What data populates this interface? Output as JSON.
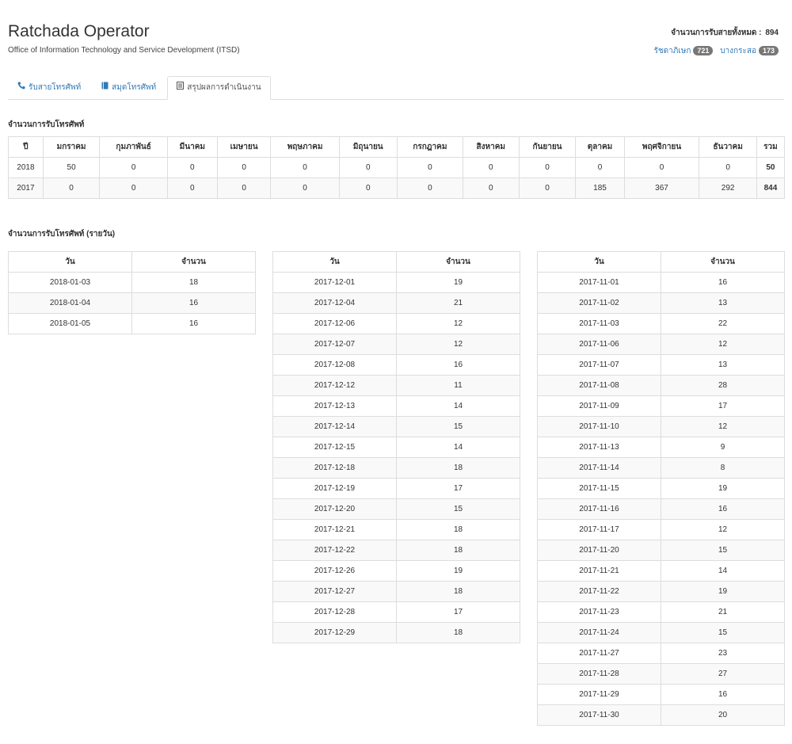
{
  "app": {
    "title": "Ratchada Operator",
    "subtitle": "Office of Information Technology and Service Development (ITSD)"
  },
  "summary": {
    "label": "จำนวนการรับสายทั้งหมด :",
    "total": "894",
    "branches": [
      {
        "name": "รัชดาภิเษก",
        "count": "721"
      },
      {
        "name": "บางกระสอ",
        "count": "173"
      }
    ]
  },
  "tabs": [
    {
      "label": "รับสายโทรศัพท์",
      "icon": "phone-icon"
    },
    {
      "label": "สมุดโทรศัพท์",
      "icon": "book-icon"
    },
    {
      "label": "สรุปผลการดำเนินงาน",
      "icon": "list-icon",
      "active": true
    }
  ],
  "monthly": {
    "title": "จำนวนการรับโทรศัพท์",
    "headers": [
      "ปี",
      "มกราคม",
      "กุมภาพันธ์",
      "มีนาคม",
      "เมษายน",
      "พฤษภาคม",
      "มิถุนายน",
      "กรกฎาคม",
      "สิงหาคม",
      "กันยายน",
      "ตุลาคม",
      "พฤศจิกายน",
      "ธันวาคม",
      "รวม"
    ],
    "rows": [
      [
        "2018",
        "50",
        "0",
        "0",
        "0",
        "0",
        "0",
        "0",
        "0",
        "0",
        "0",
        "0",
        "0",
        "50"
      ],
      [
        "2017",
        "0",
        "0",
        "0",
        "0",
        "0",
        "0",
        "0",
        "0",
        "0",
        "185",
        "367",
        "292",
        "844"
      ]
    ]
  },
  "daily": {
    "title": "จำนวนการรับโทรศัพท์ (รายวัน)",
    "headers": [
      "วัน",
      "จำนวน"
    ],
    "tables": [
      [
        [
          "2018-01-03",
          "18"
        ],
        [
          "2018-01-04",
          "16"
        ],
        [
          "2018-01-05",
          "16"
        ]
      ],
      [
        [
          "2017-12-01",
          "19"
        ],
        [
          "2017-12-04",
          "21"
        ],
        [
          "2017-12-06",
          "12"
        ],
        [
          "2017-12-07",
          "12"
        ],
        [
          "2017-12-08",
          "16"
        ],
        [
          "2017-12-12",
          "11"
        ],
        [
          "2017-12-13",
          "14"
        ],
        [
          "2017-12-14",
          "15"
        ],
        [
          "2017-12-15",
          "14"
        ],
        [
          "2017-12-18",
          "18"
        ],
        [
          "2017-12-19",
          "17"
        ],
        [
          "2017-12-20",
          "15"
        ],
        [
          "2017-12-21",
          "18"
        ],
        [
          "2017-12-22",
          "18"
        ],
        [
          "2017-12-26",
          "19"
        ],
        [
          "2017-12-27",
          "18"
        ],
        [
          "2017-12-28",
          "17"
        ],
        [
          "2017-12-29",
          "18"
        ]
      ],
      [
        [
          "2017-11-01",
          "16"
        ],
        [
          "2017-11-02",
          "13"
        ],
        [
          "2017-11-03",
          "22"
        ],
        [
          "2017-11-06",
          "12"
        ],
        [
          "2017-11-07",
          "13"
        ],
        [
          "2017-11-08",
          "28"
        ],
        [
          "2017-11-09",
          "17"
        ],
        [
          "2017-11-10",
          "12"
        ],
        [
          "2017-11-13",
          "9"
        ],
        [
          "2017-11-14",
          "8"
        ],
        [
          "2017-11-15",
          "19"
        ],
        [
          "2017-11-16",
          "16"
        ],
        [
          "2017-11-17",
          "12"
        ],
        [
          "2017-11-20",
          "15"
        ],
        [
          "2017-11-21",
          "14"
        ],
        [
          "2017-11-22",
          "19"
        ],
        [
          "2017-11-23",
          "21"
        ],
        [
          "2017-11-24",
          "15"
        ],
        [
          "2017-11-27",
          "23"
        ],
        [
          "2017-11-28",
          "27"
        ],
        [
          "2017-11-29",
          "16"
        ],
        [
          "2017-11-30",
          "20"
        ]
      ]
    ]
  }
}
